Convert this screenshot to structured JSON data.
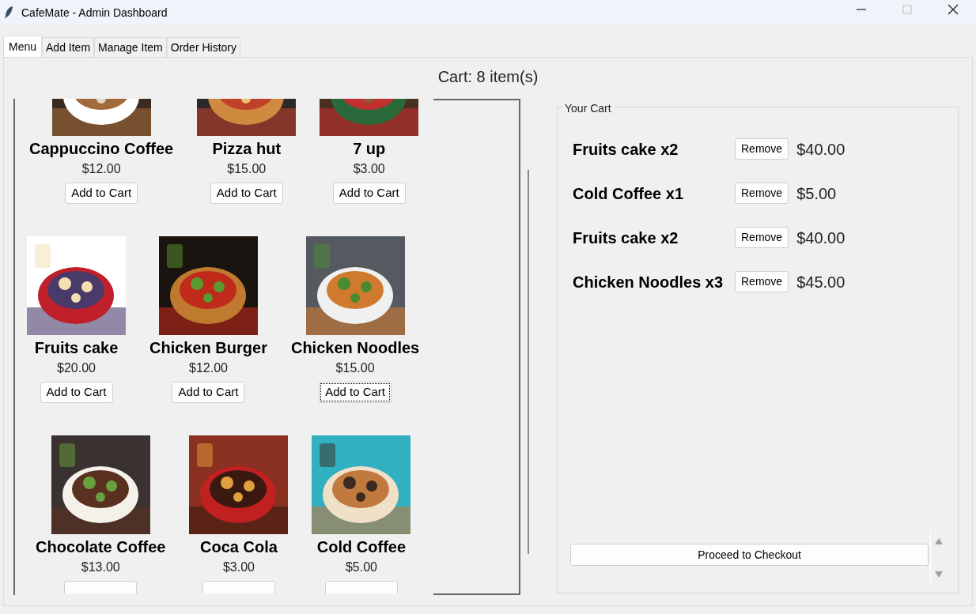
{
  "window": {
    "title": "CafeMate - Admin Dashboard"
  },
  "tabs": [
    {
      "label": "Menu",
      "selected": true
    },
    {
      "label": "Add Item",
      "selected": false
    },
    {
      "label": "Manage Item",
      "selected": false
    },
    {
      "label": "Order History",
      "selected": false
    }
  ],
  "cart_count": "Cart: 8 item(s)",
  "menu": [
    [
      {
        "name": "Cappuccino Coffee",
        "price": "$12.00",
        "button": "Add to Cart",
        "focused": false
      },
      {
        "name": "Pizza hut",
        "price": "$15.00",
        "button": "Add to Cart",
        "focused": false
      },
      {
        "name": "7 up",
        "price": "$3.00",
        "button": "Add to Cart",
        "focused": false
      }
    ],
    [
      {
        "name": "Fruits cake",
        "price": "$20.00",
        "button": "Add to Cart",
        "focused": false
      },
      {
        "name": "Chicken Burger",
        "price": "$12.00",
        "button": "Add to Cart",
        "focused": false
      },
      {
        "name": "Chicken Noodles",
        "price": "$15.00",
        "button": "Add to Cart",
        "focused": true
      }
    ],
    [
      {
        "name": "Chocolate Coffee",
        "price": "$13.00",
        "focused": false
      },
      {
        "name": "Coca Cola",
        "price": "$3.00",
        "focused": false
      },
      {
        "name": "Cold Coffee",
        "price": "$5.00",
        "focused": false
      }
    ]
  ],
  "cart": {
    "title": "Your Cart",
    "items": [
      {
        "name": "Fruits cake x2",
        "button": "Remove",
        "price": "$40.00"
      },
      {
        "name": "Cold Coffee x1",
        "button": "Remove",
        "price": "$5.00"
      },
      {
        "name": "Fruits cake x2",
        "button": "Remove",
        "price": "$40.00"
      },
      {
        "name": "Chicken Noodles x3",
        "button": "Remove",
        "price": "$45.00"
      }
    ],
    "checkout": "Proceed to Checkout"
  }
}
